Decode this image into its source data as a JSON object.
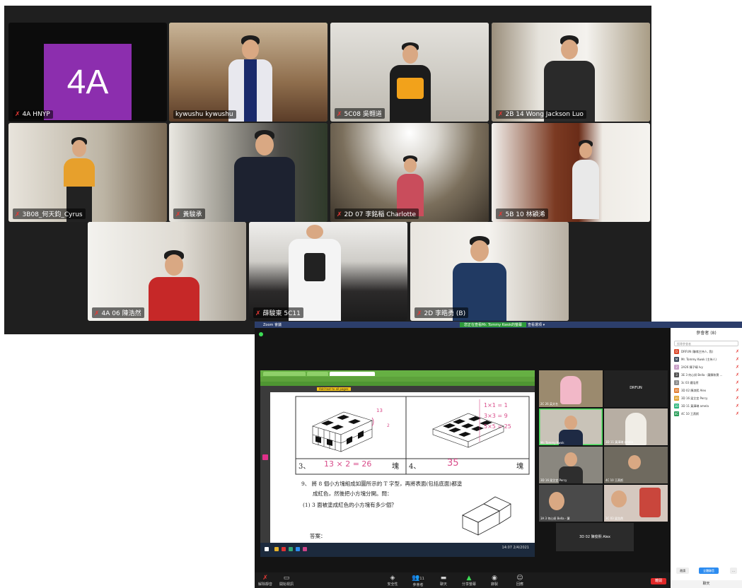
{
  "gallery": {
    "tiles": [
      {
        "name": "4A HNYP",
        "label": "4A"
      },
      {
        "name": "kywushu kywushu"
      },
      {
        "name": "5C08 吳翱道"
      },
      {
        "name": "2B 14 Wong Jackson Luo"
      },
      {
        "name": "3B08_何天鈞_Cyrus"
      },
      {
        "name": "黃駿承"
      },
      {
        "name": "2D 07 李銘稲 Charlotte"
      },
      {
        "name": "5B 10 林穎浠"
      },
      {
        "name": "4A 06 陳浩然"
      },
      {
        "name": "薛駿東 5C11"
      },
      {
        "name": "2D 李皓勇 (B)"
      }
    ]
  },
  "zoom": {
    "title": "Zoom 會議",
    "share_banner": "您正在查看Mr. Tommy Kwok的螢幕",
    "view_options": "查看選項 ▾",
    "pdf_zoom": "Add text to all pages",
    "page_content": {
      "q3_label": "3、",
      "q3_answer": "13 × 2 = 26",
      "q3_unit": "塊",
      "q4_label": "4、",
      "q4_answer": "35",
      "q4_unit": "塊",
      "hand_13": "13",
      "hand_2": "2",
      "calc_1": "1×1 = 1",
      "calc_2": "3×3 = 9",
      "calc_3": "5×5 = 25",
      "q9_line1": "9、 將 8 個小方塊組成如圖所示的 T 字型，再將表面(包括底面)都塗",
      "q9_line2": "成紅色，然後把小方塊分開。問：",
      "q9_sub": "(1) 3 面被塗成紅色的小方塊有多少個？",
      "answer_label": "答案："
    },
    "taskbar_time": "14:07",
    "taskbar_date": "2/4/2021",
    "strip": [
      {
        "name": "2C 26 英文名"
      },
      {
        "name": "DRFUN"
      },
      {
        "name": "Mr. Tommy Kwok"
      },
      {
        "name": "3D 11 黃澤琳 ameia"
      },
      {
        "name": "3D 16 梁芷宜 Percy"
      },
      {
        "name": "4C 10 王燕斯"
      },
      {
        "name": "3A 3 何心妍 Bella - 蘭"
      },
      {
        "name": "3C 03 梁浩然"
      },
      {
        "name": "3D 02 陳俊熙 Alex"
      }
    ],
    "bottom": {
      "mute": "解除靜音",
      "video": "開始視訊",
      "security": "安全性",
      "participants": "參會者",
      "participants_count": "11",
      "chat": "聊天",
      "share": "分享螢幕",
      "record": "錄製",
      "reactions": "回應",
      "end": "離開"
    },
    "panel": {
      "title": "參會者 (8)",
      "search": "搜尋參會者",
      "rows": [
        {
          "av": "D",
          "color": "#d9472b",
          "name": "DRFUN (聯席主持人, 我)"
        },
        {
          "av": "M",
          "color": "#3c4a5c",
          "name": "Mr. Tommy Kwok (主持人)"
        },
        {
          "av": "2",
          "color": "#c8a0c8",
          "name": "2A26 陳子晴 Ivy"
        },
        {
          "av": "3",
          "color": "#555555",
          "name": "3E 3 何心妍 Bella - 蘭陳和寶 ..."
        },
        {
          "av": "3",
          "color": "#8c8c8c",
          "name": "3c 03 鍾浩然"
        },
        {
          "av": "3D",
          "color": "#e07a2b",
          "name": "3D 02 陳濟熙 Alex"
        },
        {
          "av": "3D",
          "color": "#e0a12b",
          "name": "3D 16 梁芷宜 Percy"
        },
        {
          "av": "3D",
          "color": "#2bb57a",
          "name": "3D 11 黃澤琳 amela"
        },
        {
          "av": "4C",
          "color": "#2b9e5a",
          "name": "4C 10 王燕斯"
        }
      ],
      "invite": "邀請",
      "mute_all": "全體靜音",
      "more": "...",
      "chat": "聊天"
    }
  }
}
